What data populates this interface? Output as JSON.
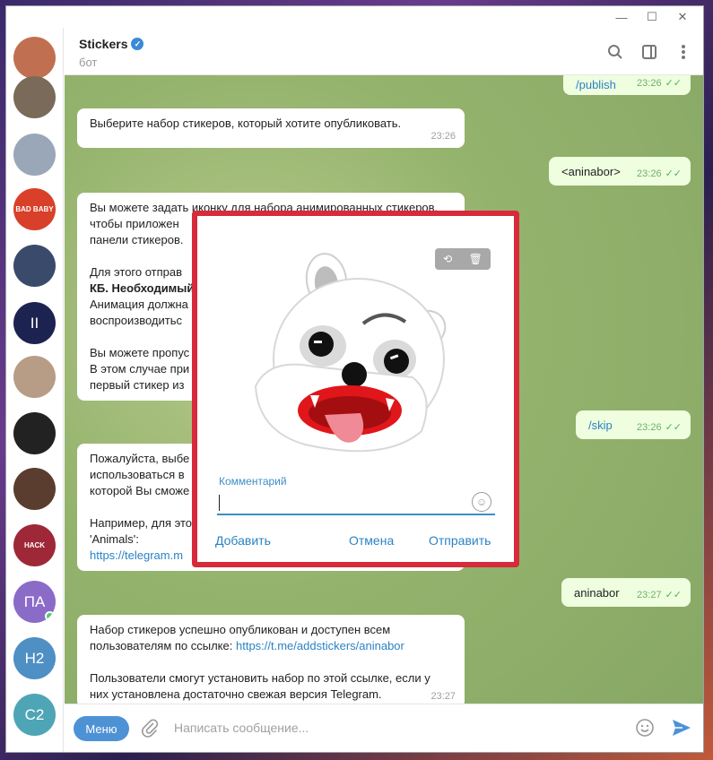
{
  "window": {
    "minimize": "—",
    "maximize": "☐",
    "close": "✕"
  },
  "sidebar": {
    "avatars": [
      {
        "label": "",
        "color": "#c07050"
      },
      {
        "label": "",
        "color": "#7a6a5a"
      },
      {
        "label": "",
        "color": "#9aa7b8"
      },
      {
        "label": "BAD BABY",
        "color": "#d8402a"
      },
      {
        "label": "",
        "color": "#3a4a6a"
      },
      {
        "label": "II",
        "color": "#1d2350"
      },
      {
        "label": "",
        "color": "#b79c86"
      },
      {
        "label": "",
        "color": "#222222"
      },
      {
        "label": "",
        "color": "#5a3d2e"
      },
      {
        "label": "HACK",
        "color": "#9e2838"
      },
      {
        "label": "ПА",
        "color": "#8b6bc8"
      },
      {
        "label": "Н2",
        "color": "#4e8fc4"
      },
      {
        "label": "С2",
        "color": "#4ea5b5"
      }
    ]
  },
  "header": {
    "title": "Stickers",
    "subtitle": "бот"
  },
  "messages": {
    "m1": {
      "text": "/publish",
      "time": "23:26"
    },
    "m2": {
      "text": "Выберите набор стикеров, который хотите опубликовать.",
      "time": "23:26"
    },
    "m3": {
      "text": "<aninabor>",
      "time": "23:26"
    },
    "m4": {
      "l1": "Вы можете задать иконку для набора анимированных стикеров,",
      "l2": "чтобы приложен",
      "l3": "панели стикеров.",
      "l4": "Для этого отправ",
      "l5": "КБ. Необходимый",
      "l6": "Анимация должна",
      "l7": "воспроизводитьс",
      "l8": "Вы можете пропус",
      "l9": "В этом случае при",
      "l10": "первый стикер из"
    },
    "m5": {
      "text": "/skip",
      "time": "23:26"
    },
    "m6": {
      "l1": "Пожалуйста, выбе",
      "l2": "использоваться в",
      "l3": "которой Вы сможе",
      "l4": "Например, для это",
      "l5": "'Animals':",
      "l6": "https://telegram.m"
    },
    "m7": {
      "text": "aninabor",
      "time": "23:27"
    },
    "m8": {
      "l1": "Набор стикеров успешно опубликован и доступен всем",
      "l2a": "пользователям по ссылке: ",
      "l2b": "https://t.me/addstickers/aninabor",
      "l3": "Пользователи смогут установить набор по этой ссылке, если у",
      "l4": "них установлена достаточно свежая версия Telegram.",
      "time": "23:27"
    }
  },
  "composer": {
    "menu": "Меню",
    "placeholder": "Написать сообщение..."
  },
  "dialog": {
    "caption_label": "Комментарий",
    "add": "Добавить",
    "cancel": "Отмена",
    "send": "Отправить"
  }
}
